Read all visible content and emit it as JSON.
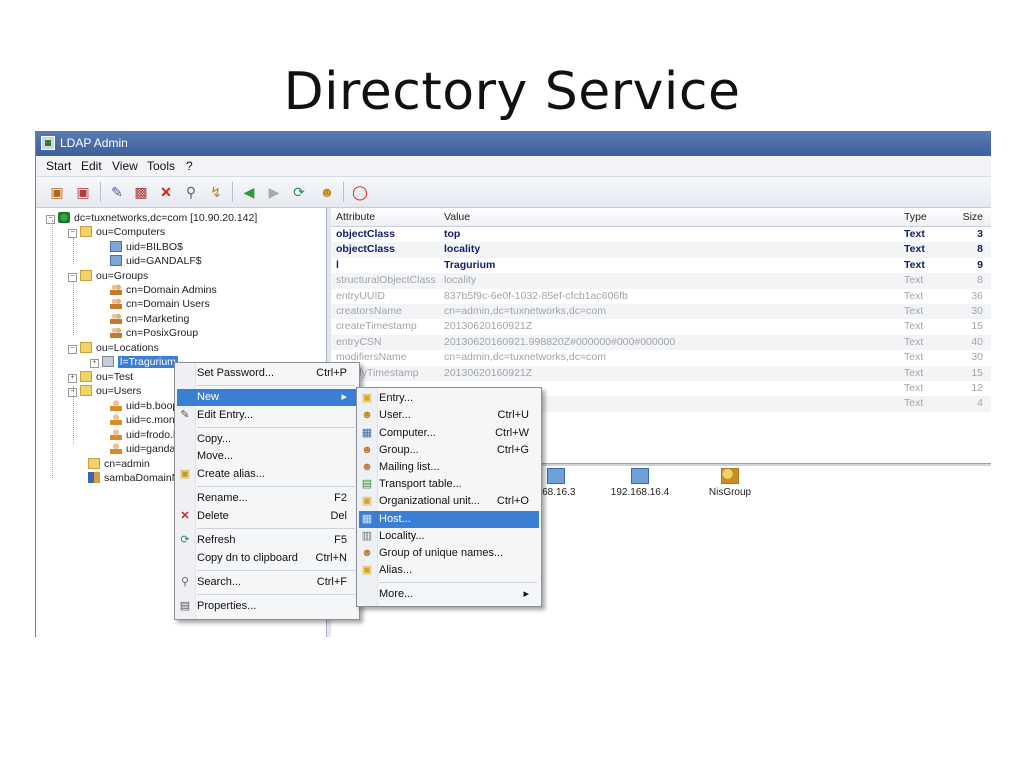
{
  "slide_title": "Directory Service",
  "window": {
    "title": "LDAP Admin"
  },
  "menubar": [
    "Start",
    "Edit",
    "View",
    "Tools",
    "?"
  ],
  "toolbar_icons": [
    "connect-icon",
    "disconnect-icon",
    "edit-icon",
    "save-icon",
    "delete-icon",
    "search-icon",
    "lightning-icon",
    "back-icon",
    "forward-icon",
    "refresh-icon",
    "user-icon",
    "exit-icon"
  ],
  "tree": {
    "root": "dc=tuxnetworks,dc=com [10.90.20.142]",
    "computers": "ou=Computers",
    "bilbo": "uid=BILBO$",
    "gandalf_c": "uid=GANDALF$",
    "groups": "ou=Groups",
    "domain_admins": "cn=Domain Admins",
    "domain_users": "cn=Domain Users",
    "marketing": "cn=Marketing",
    "posix": "cn=PosixGroup",
    "locations": "ou=Locations",
    "tragurium": "l=Tragurium",
    "test": "ou=Test",
    "users": "ou=Users",
    "u_boop": "uid=b.boop",
    "u_cmon": "uid=c.mon",
    "u_frodo": "uid=frodo.b",
    "u_gandal": "uid=gandal",
    "admin": "cn=admin",
    "samba": "sambaDomainN"
  },
  "grid": {
    "headers": {
      "attribute": "Attribute",
      "value": "Value",
      "type": "Type",
      "size": "Size"
    },
    "rows": [
      {
        "attr": "objectClass",
        "value": "top",
        "type": "Text",
        "size": "3"
      },
      {
        "attr": "objectClass",
        "value": "locality",
        "type": "Text",
        "size": "8"
      },
      {
        "attr": "l",
        "value": "Tragurium",
        "type": "Text",
        "size": "9"
      },
      {
        "attr": "structuralObjectClass",
        "value": "locality",
        "type": "Text",
        "size": "8"
      },
      {
        "attr": "entryUUID",
        "value": "837b5f9c-6e0f-1032-85ef-cfcb1ac606fb",
        "type": "Text",
        "size": "36"
      },
      {
        "attr": "creatorsName",
        "value": "cn=admin,dc=tuxnetworks,dc=com",
        "type": "Text",
        "size": "30"
      },
      {
        "attr": "createTimestamp",
        "value": "20130620160921Z",
        "type": "Text",
        "size": "15"
      },
      {
        "attr": "entryCSN",
        "value": "20130620160921.998820Z#000000#000#000000",
        "type": "Text",
        "size": "40"
      },
      {
        "attr": "modifiersName",
        "value": "cn=admin,dc=tuxnetworks,dc=com",
        "type": "Text",
        "size": "30"
      },
      {
        "attr": "modifyTimestamp",
        "value": "20130620160921Z",
        "type": "Text",
        "size": "15"
      },
      {
        "attr": "",
        "value": "",
        "type": "Text",
        "size": "12"
      },
      {
        "attr": "",
        "value": "",
        "type": "Text",
        "size": "4"
      }
    ]
  },
  "hosts": [
    "168.16.3",
    "192.168.16.4",
    "NisGroup"
  ],
  "context_menu": {
    "set_password": "Set Password...",
    "set_password_sc": "Ctrl+P",
    "new": "New",
    "edit_entry": "Edit Entry...",
    "copy": "Copy...",
    "move": "Move...",
    "create_alias": "Create alias...",
    "rename": "Rename...",
    "rename_sc": "F2",
    "delete": "Delete",
    "delete_sc": "Del",
    "refresh": "Refresh",
    "refresh_sc": "F5",
    "copy_dn": "Copy dn to clipboard",
    "copy_dn_sc": "Ctrl+N",
    "search": "Search...",
    "search_sc": "Ctrl+F",
    "properties": "Properties..."
  },
  "submenu": {
    "entry": "Entry...",
    "user": "User...",
    "user_sc": "Ctrl+U",
    "computer": "Computer...",
    "computer_sc": "Ctrl+W",
    "group": "Group...",
    "group_sc": "Ctrl+G",
    "mailing_list": "Mailing list...",
    "transport_table": "Transport table...",
    "org_unit": "Organizational unit...",
    "org_unit_sc": "Ctrl+O",
    "host": "Host...",
    "locality": "Locality...",
    "group_unique": "Group of unique names...",
    "alias": "Alias...",
    "more": "More..."
  }
}
